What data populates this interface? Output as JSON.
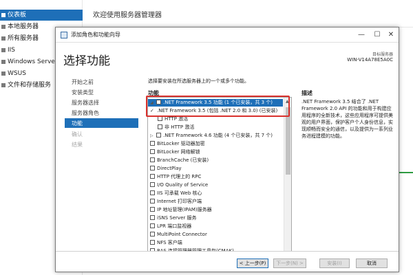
{
  "server_manager": {
    "nav_items": [
      {
        "label": "仪表板",
        "active": true
      },
      {
        "label": "本地服务器"
      },
      {
        "label": "所有服务器"
      },
      {
        "label": "IIS"
      },
      {
        "label": "Windows Server"
      },
      {
        "label": "WSUS"
      },
      {
        "label": "文件和存储服务"
      }
    ],
    "welcome": "欢迎使用服务器管理器"
  },
  "wizard": {
    "title": "添加角色和功能向导",
    "heading": "选择功能",
    "target_label": "目标服务器",
    "target_server": "WIN-V14A78E5A0C",
    "window_controls": {
      "minimize": "—",
      "maximize": "☐",
      "close": "✕"
    },
    "steps": [
      {
        "label": "开始之前"
      },
      {
        "label": "安装类型"
      },
      {
        "label": "服务器选择"
      },
      {
        "label": "服务器角色"
      },
      {
        "label": "功能",
        "active": true
      },
      {
        "label": "确认",
        "disabled": true
      },
      {
        "label": "结果",
        "disabled": true
      }
    ],
    "instructions": "选择要安装在所选服务器上的一个或多个功能。",
    "features_header": "功能",
    "description_header": "描述",
    "features": [
      {
        "label": ".NET Framework 3.5 功能 (1 个已安装，共 3 个)",
        "expand": "◢",
        "state": "partial",
        "indent": 0,
        "selected": true
      },
      {
        "label": ".NET Framework 3.5 (包括 .NET 2.0 和 3.0) (已安装)",
        "check": "✓",
        "state": "checked",
        "indent": 1
      },
      {
        "label": "HTTP 激活",
        "state": "unchecked",
        "indent": 1
      },
      {
        "label": "非 HTTP 激活",
        "state": "unchecked",
        "indent": 1
      },
      {
        "label": ".NET Framework 4.6 功能 (4 个已安装，共 7 个)",
        "expand": "▷",
        "state": "partial",
        "indent": 0
      },
      {
        "label": "BitLocker 驱动器加密",
        "state": "unchecked",
        "indent": 0
      },
      {
        "label": "BitLocker 网络解锁",
        "state": "unchecked",
        "indent": 0
      },
      {
        "label": "BranchCache (已安装)",
        "state": "checked",
        "indent": 0
      },
      {
        "label": "DirectPlay",
        "state": "unchecked",
        "indent": 0
      },
      {
        "label": "HTTP 代理上的 RPC",
        "state": "unchecked",
        "indent": 0
      },
      {
        "label": "I/O Quality of Service",
        "state": "unchecked",
        "indent": 0
      },
      {
        "label": "IIS 可承载 Web 核心",
        "state": "unchecked",
        "indent": 0
      },
      {
        "label": "Internet 打印客户端",
        "state": "unchecked",
        "indent": 0
      },
      {
        "label": "IP 地址管理(IPAM)服务器",
        "state": "unchecked",
        "indent": 0
      },
      {
        "label": "iSNS Server 服务",
        "state": "unchecked",
        "indent": 0
      },
      {
        "label": "LPR 端口监视器",
        "state": "unchecked",
        "indent": 0
      },
      {
        "label": "MultiPoint Connector",
        "state": "unchecked",
        "indent": 0
      },
      {
        "label": "NFS 客户端",
        "state": "unchecked",
        "indent": 0
      },
      {
        "label": "RAS 连接管理器管理工具包(CMAK)",
        "state": "unchecked",
        "indent": 0
      }
    ],
    "scroll": {
      "up": "▲",
      "down": "▼"
    },
    "description": ".NET Framework 3.5 结合了 .NET Framework 2.0 API 的功能和用于构建应用程序的全新技术，这些应用程序可提供美观的用户界面，保护客户个人身份信息，实现顺畅而安全的通信，以及提供为一系列业务进程建模的功能。",
    "buttons": {
      "prev": "< 上一步(P)",
      "next": "下一步(N) >",
      "install": "安装(I)",
      "cancel": "取消"
    }
  },
  "colors": {
    "accent": "#1e6fb8",
    "highlight": "#d9302c"
  }
}
